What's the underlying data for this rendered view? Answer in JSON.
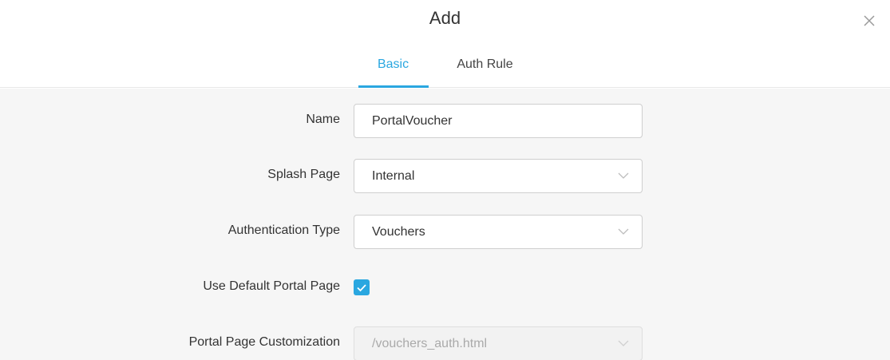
{
  "dialog": {
    "title": "Add",
    "close_icon": "close-icon"
  },
  "tabs": [
    {
      "label": "Basic",
      "active": true
    },
    {
      "label": "Auth Rule",
      "active": false
    }
  ],
  "form": {
    "name": {
      "label": "Name",
      "value": "PortalVoucher"
    },
    "splash_page": {
      "label": "Splash Page",
      "value": "Internal"
    },
    "authentication_type": {
      "label": "Authentication Type",
      "value": "Vouchers"
    },
    "use_default_portal_page": {
      "label": "Use Default Portal Page",
      "checked": true
    },
    "portal_page_customization": {
      "label": "Portal Page Customization",
      "value": "/vouchers_auth.html",
      "disabled": true
    }
  },
  "colors": {
    "accent": "#2aa7e0",
    "panel_bg": "#f6f6f6"
  }
}
